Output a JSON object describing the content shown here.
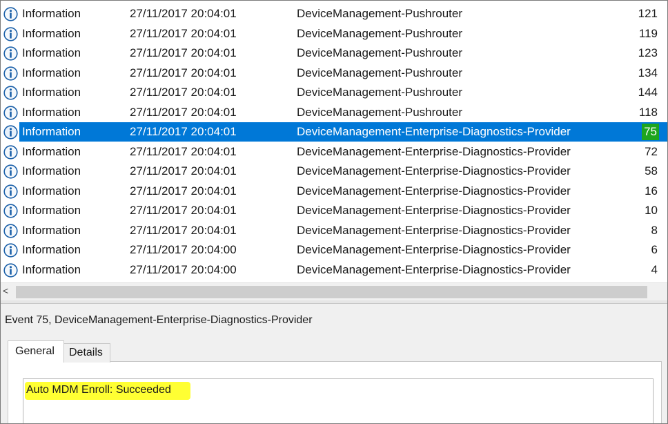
{
  "events": [
    {
      "level": "Information",
      "date": "27/11/2017 20:04:01",
      "source": "DeviceManagement-Pushrouter",
      "event_id": "121"
    },
    {
      "level": "Information",
      "date": "27/11/2017 20:04:01",
      "source": "DeviceManagement-Pushrouter",
      "event_id": "119"
    },
    {
      "level": "Information",
      "date": "27/11/2017 20:04:01",
      "source": "DeviceManagement-Pushrouter",
      "event_id": "123"
    },
    {
      "level": "Information",
      "date": "27/11/2017 20:04:01",
      "source": "DeviceManagement-Pushrouter",
      "event_id": "134"
    },
    {
      "level": "Information",
      "date": "27/11/2017 20:04:01",
      "source": "DeviceManagement-Pushrouter",
      "event_id": "144"
    },
    {
      "level": "Information",
      "date": "27/11/2017 20:04:01",
      "source": "DeviceManagement-Pushrouter",
      "event_id": "118"
    },
    {
      "level": "Information",
      "date": "27/11/2017 20:04:01",
      "source": "DeviceManagement-Enterprise-Diagnostics-Provider",
      "event_id": "75",
      "selected": true
    },
    {
      "level": "Information",
      "date": "27/11/2017 20:04:01",
      "source": "DeviceManagement-Enterprise-Diagnostics-Provider",
      "event_id": "72"
    },
    {
      "level": "Information",
      "date": "27/11/2017 20:04:01",
      "source": "DeviceManagement-Enterprise-Diagnostics-Provider",
      "event_id": "58"
    },
    {
      "level": "Information",
      "date": "27/11/2017 20:04:01",
      "source": "DeviceManagement-Enterprise-Diagnostics-Provider",
      "event_id": "16"
    },
    {
      "level": "Information",
      "date": "27/11/2017 20:04:01",
      "source": "DeviceManagement-Enterprise-Diagnostics-Provider",
      "event_id": "10"
    },
    {
      "level": "Information",
      "date": "27/11/2017 20:04:01",
      "source": "DeviceManagement-Enterprise-Diagnostics-Provider",
      "event_id": "8"
    },
    {
      "level": "Information",
      "date": "27/11/2017 20:04:00",
      "source": "DeviceManagement-Enterprise-Diagnostics-Provider",
      "event_id": "6"
    },
    {
      "level": "Information",
      "date": "27/11/2017 20:04:00",
      "source": "DeviceManagement-Enterprise-Diagnostics-Provider",
      "event_id": "4"
    }
  ],
  "row_icon": "information-icon",
  "scroll_left_glyph": "<",
  "detail": {
    "title": "Event 75, DeviceManagement-Enterprise-Diagnostics-Provider",
    "tabs": [
      {
        "label": "General",
        "active": true
      },
      {
        "label": "Details",
        "active": false
      }
    ],
    "message": "Auto MDM Enroll: Succeeded"
  },
  "colors": {
    "selection": "#0078d7",
    "event_id_highlight": "#1ea51e",
    "message_highlight": "#ffff33",
    "info_icon": "#1a5fa8"
  }
}
